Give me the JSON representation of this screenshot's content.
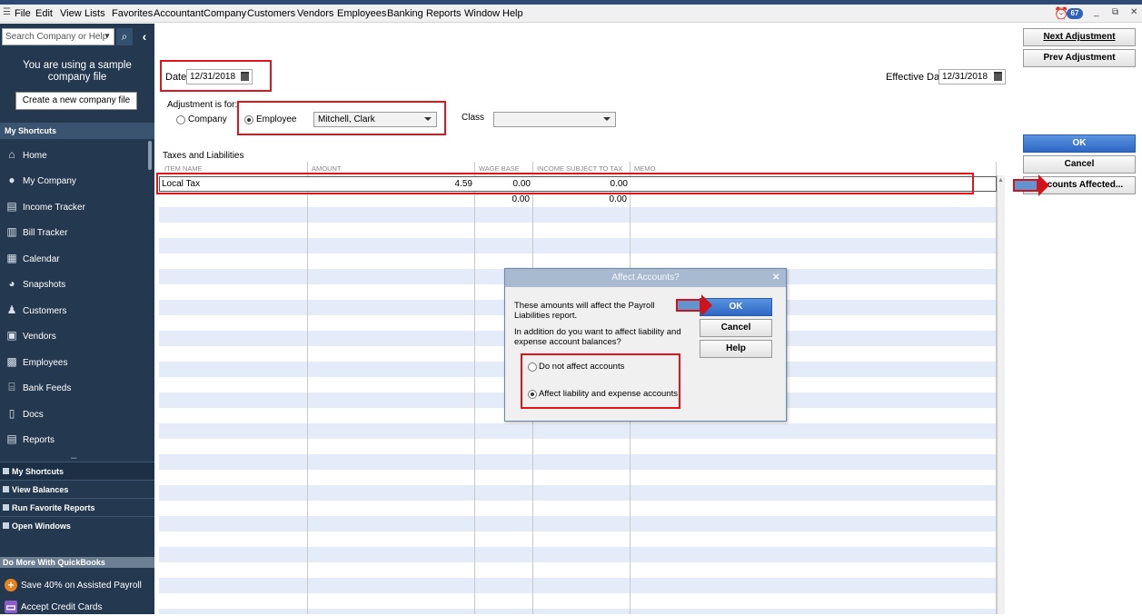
{
  "menu": [
    "File",
    "Edit",
    "View",
    "Lists",
    "Favorites",
    "Accountant",
    "Company",
    "Customers",
    "Vendors",
    "Employees",
    "Banking",
    "Reports",
    "Window",
    "Help"
  ],
  "notifications": {
    "count": "67"
  },
  "sidebar": {
    "search_placeholder": "Search Company or Help",
    "sample_text": "You are using a sample company file",
    "create_button": "Create a new company file",
    "shortcuts_header": "My Shortcuts",
    "items": [
      {
        "label": "Home",
        "icon": "home-icon"
      },
      {
        "label": "My Company",
        "icon": "company-icon"
      },
      {
        "label": "Income Tracker",
        "icon": "income-icon"
      },
      {
        "label": "Bill Tracker",
        "icon": "bill-icon"
      },
      {
        "label": "Calendar",
        "icon": "calendar-icon"
      },
      {
        "label": "Snapshots",
        "icon": "pie-chart-icon"
      },
      {
        "label": "Customers",
        "icon": "person-icon"
      },
      {
        "label": "Vendors",
        "icon": "vendor-icon"
      },
      {
        "label": "Employees",
        "icon": "employee-icon"
      },
      {
        "label": "Bank Feeds",
        "icon": "bank-icon"
      },
      {
        "label": "Docs",
        "icon": "document-icon"
      },
      {
        "label": "Reports",
        "icon": "report-icon"
      }
    ],
    "sections": [
      "My Shortcuts",
      "View Balances",
      "Run Favorite Reports",
      "Open Windows"
    ],
    "more_header": "Do More With QuickBooks",
    "promos": [
      "Save 40% on Assisted Payroll",
      "Accept Credit Cards"
    ]
  },
  "form": {
    "date_label": "Date",
    "date_value": "12/31/2018",
    "effective_date_label": "Effective Date",
    "effective_date_value": "12/31/2018",
    "adjustment_for_label": "Adjustment is for:",
    "company_label": "Company",
    "employee_label": "Employee",
    "employee_value": "Mitchell, Clark",
    "class_label": "Class",
    "class_value": "",
    "selected_for": "Employee"
  },
  "table": {
    "title": "Taxes and Liabilities",
    "columns": [
      "ITEM NAME",
      "AMOUNT",
      "WAGE BASE",
      "INCOME SUBJECT TO TAX",
      "MEMO"
    ],
    "rows": [
      {
        "item": "Local Tax",
        "amount": "4.59",
        "wage_base": "0.00",
        "income_subject": "0.00",
        "memo": ""
      },
      {
        "item": "",
        "amount": "",
        "wage_base": "0.00",
        "income_subject": "0.00",
        "memo": ""
      }
    ]
  },
  "buttons": {
    "next_adjustment": "Next Adjustment",
    "prev_adjustment": "Prev Adjustment",
    "ok": "OK",
    "cancel": "Cancel",
    "accounts_affected": "Accounts Affected..."
  },
  "dialog": {
    "title": "Affect Accounts?",
    "text1": "These amounts will affect the Payroll Liabilities report.",
    "text2": "In addition do you want to affect liability and expense account balances?",
    "ok": "OK",
    "cancel": "Cancel",
    "help": "Help",
    "option1": "Do not affect accounts",
    "option2": "Affect liability and expense accounts",
    "selected_option": "Affect liability and expense accounts"
  },
  "colors": {
    "highlight": "#e0151e",
    "sidebar": "#243950",
    "stripe": "#e3ecf8",
    "primary_button": "#2d67c4"
  }
}
